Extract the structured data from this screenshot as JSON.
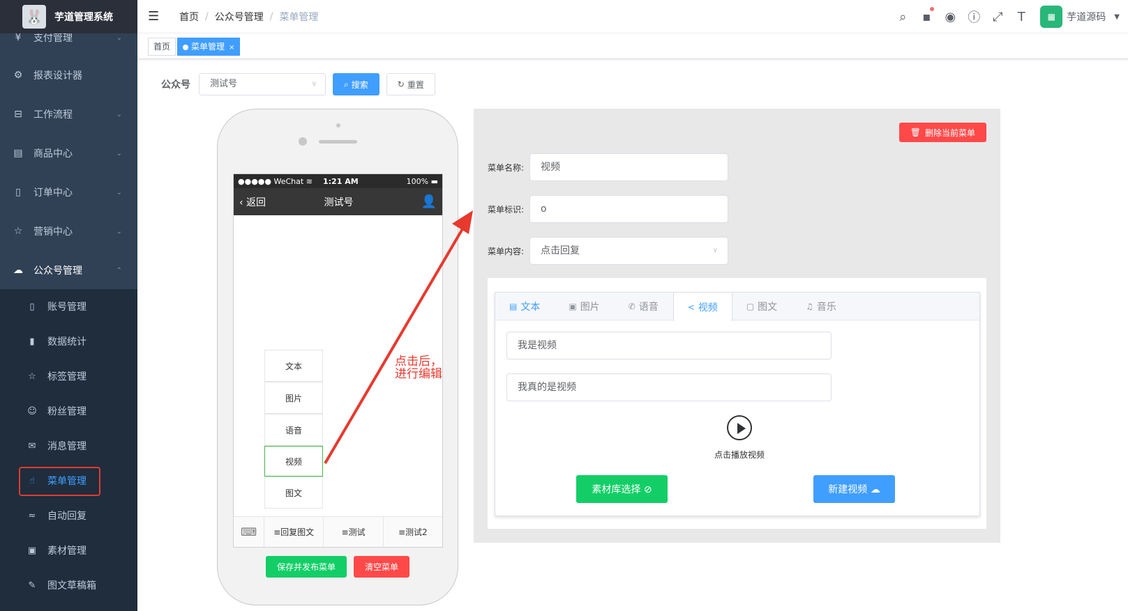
{
  "app": {
    "title": "芋道管理系统",
    "logo_icon": "rabbit-logo"
  },
  "sidebar": {
    "items": [
      {
        "label": "支付管理",
        "icon": "yen-icon",
        "arrow": "⌄"
      },
      {
        "label": "报表设计器",
        "icon": "gear-icon",
        "arrow": ""
      },
      {
        "label": "工作流程",
        "icon": "briefcase-icon",
        "arrow": "⌄"
      },
      {
        "label": "商品中心",
        "icon": "store-icon",
        "arrow": "⌄"
      },
      {
        "label": "订单中心",
        "icon": "receipt-icon",
        "arrow": "⌄"
      },
      {
        "label": "营销中心",
        "icon": "star-icon",
        "arrow": "⌄"
      },
      {
        "label": "公众号管理",
        "icon": "wechat-icon",
        "arrow": "⌃"
      }
    ],
    "subitems": [
      {
        "label": "账号管理",
        "icon": "phone-icon"
      },
      {
        "label": "数据统计",
        "icon": "chart-icon"
      },
      {
        "label": "标签管理",
        "icon": "star-icon"
      },
      {
        "label": "粉丝管理",
        "icon": "fans-icon"
      },
      {
        "label": "消息管理",
        "icon": "mail-icon"
      },
      {
        "label": "菜单管理",
        "icon": "tap-icon",
        "active": true
      },
      {
        "label": "自动回复",
        "icon": "reply-icon"
      },
      {
        "label": "素材管理",
        "icon": "material-icon"
      },
      {
        "label": "图文草稿箱",
        "icon": "edit-icon"
      }
    ]
  },
  "navbar": {
    "breadcrumb": [
      "首页",
      "公众号管理",
      "菜单管理"
    ],
    "user": "芋道源码"
  },
  "tags": {
    "home": "首页",
    "current": "菜单管理",
    "close": "×"
  },
  "search": {
    "label": "公众号",
    "account_value": "测试号",
    "search_btn": "搜索",
    "reset_btn": "重置"
  },
  "phone": {
    "status_left": "●●●●● WeChat ≋",
    "status_time": "1:21 AM",
    "status_battery": "100% ▬",
    "back": "‹ 返回",
    "title": "测试号",
    "submenus": [
      "文本",
      "图片",
      "语音",
      "视频",
      "图文"
    ],
    "selected_submenu": "视频",
    "menus": [
      "≡回复图文",
      "≡测试",
      "≡测试2"
    ],
    "save_btn": "保存并发布菜单",
    "clear_btn": "清空菜单"
  },
  "annotation": {
    "line1": "点击后，",
    "line2": "进行编辑"
  },
  "editor": {
    "delete_btn": "删除当前菜单",
    "name_label": "菜单名称:",
    "name_value": "视频",
    "key_label": "菜单标识:",
    "key_value": "o",
    "content_label": "菜单内容:",
    "content_value": "点击回复",
    "tabs": [
      "文本",
      "图片",
      "语音",
      "视频",
      "图文",
      "音乐"
    ],
    "active_tab": "视频",
    "video_title": "我是视频",
    "video_desc": "我真的是视频",
    "play_label": "点击播放视频",
    "library_btn": "素材库选择 ⊘",
    "new_btn": "新建视频 ☁"
  },
  "colors": {
    "primary": "#409eff",
    "success": "#13ce66",
    "danger": "#ff4949",
    "sidebar": "#304156",
    "annotation": "#e8392e"
  }
}
